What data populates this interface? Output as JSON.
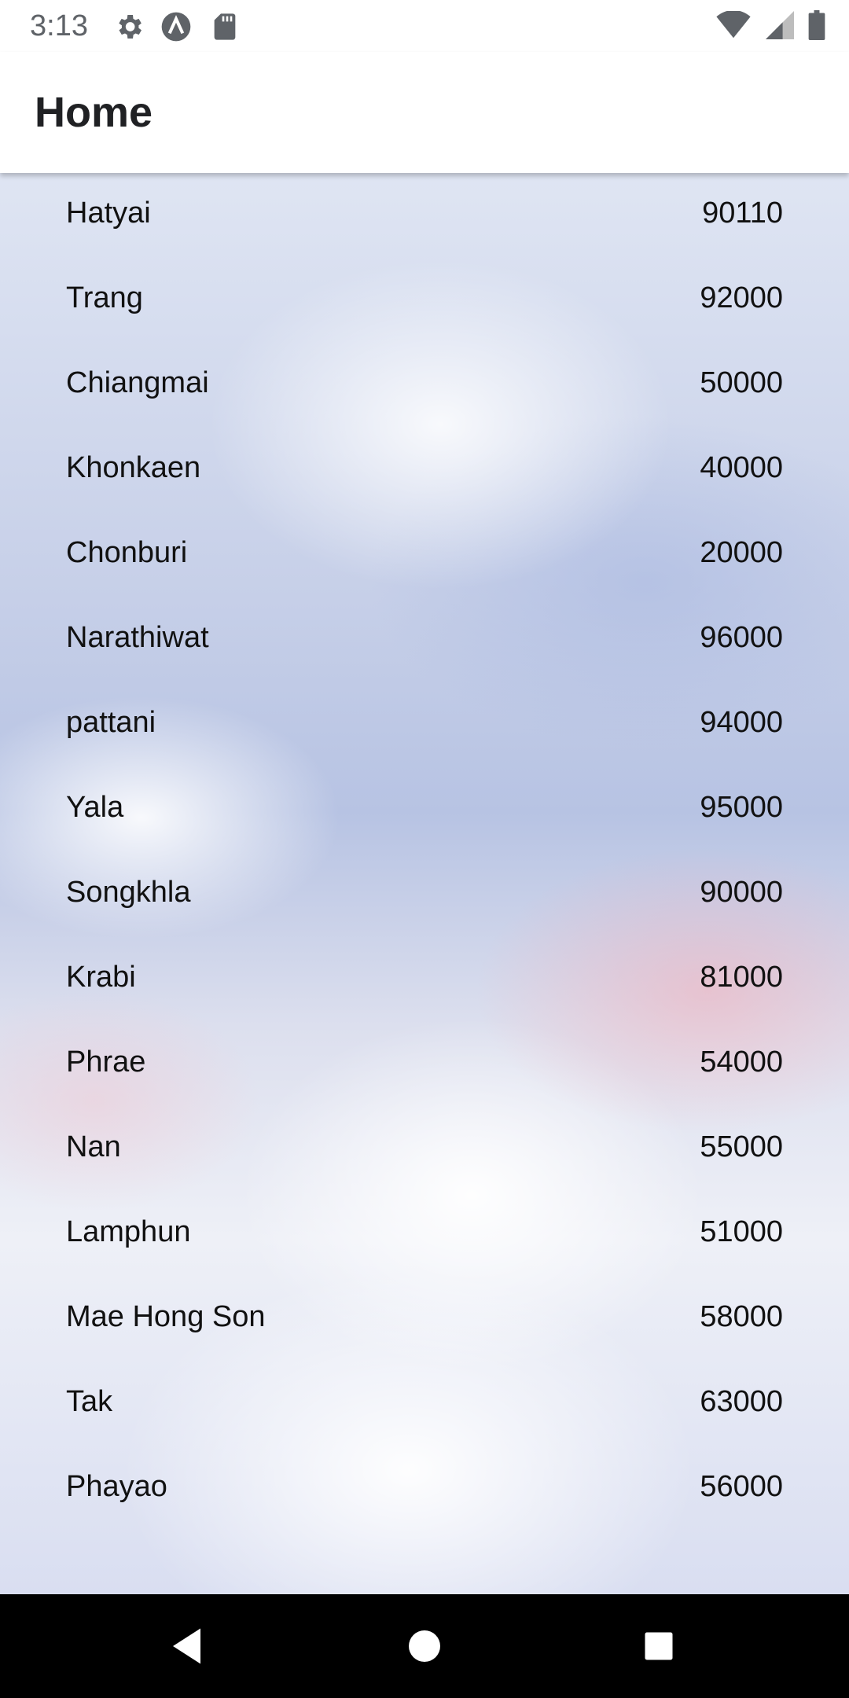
{
  "status_bar": {
    "time": "3:13",
    "icons_left": [
      "settings-icon",
      "a-icon",
      "sd-card-icon"
    ],
    "icons_right": [
      "wifi-icon",
      "signal-icon",
      "battery-icon"
    ]
  },
  "app_bar": {
    "title": "Home"
  },
  "list": {
    "items": [
      {
        "name": "Hatyai",
        "code": "90110"
      },
      {
        "name": "Trang",
        "code": "92000"
      },
      {
        "name": "Chiangmai",
        "code": "50000"
      },
      {
        "name": "Khonkaen",
        "code": "40000"
      },
      {
        "name": "Chonburi",
        "code": "20000"
      },
      {
        "name": "Narathiwat",
        "code": "96000"
      },
      {
        "name": "pattani",
        "code": "94000"
      },
      {
        "name": "Yala",
        "code": "95000"
      },
      {
        "name": "Songkhla",
        "code": "90000"
      },
      {
        "name": "Krabi",
        "code": "81000"
      },
      {
        "name": "Phrae",
        "code": "54000"
      },
      {
        "name": "Nan",
        "code": "55000"
      },
      {
        "name": "Lamphun",
        "code": "51000"
      },
      {
        "name": "Mae Hong Son",
        "code": "58000"
      },
      {
        "name": "Tak",
        "code": "63000"
      },
      {
        "name": "Phayao",
        "code": "56000"
      }
    ]
  },
  "nav_bar": {
    "buttons": [
      "back-icon",
      "home-icon",
      "recents-icon"
    ]
  },
  "colors": {
    "text": "#111111",
    "status_grey": "#5f6368",
    "nav_bg": "#000000"
  }
}
